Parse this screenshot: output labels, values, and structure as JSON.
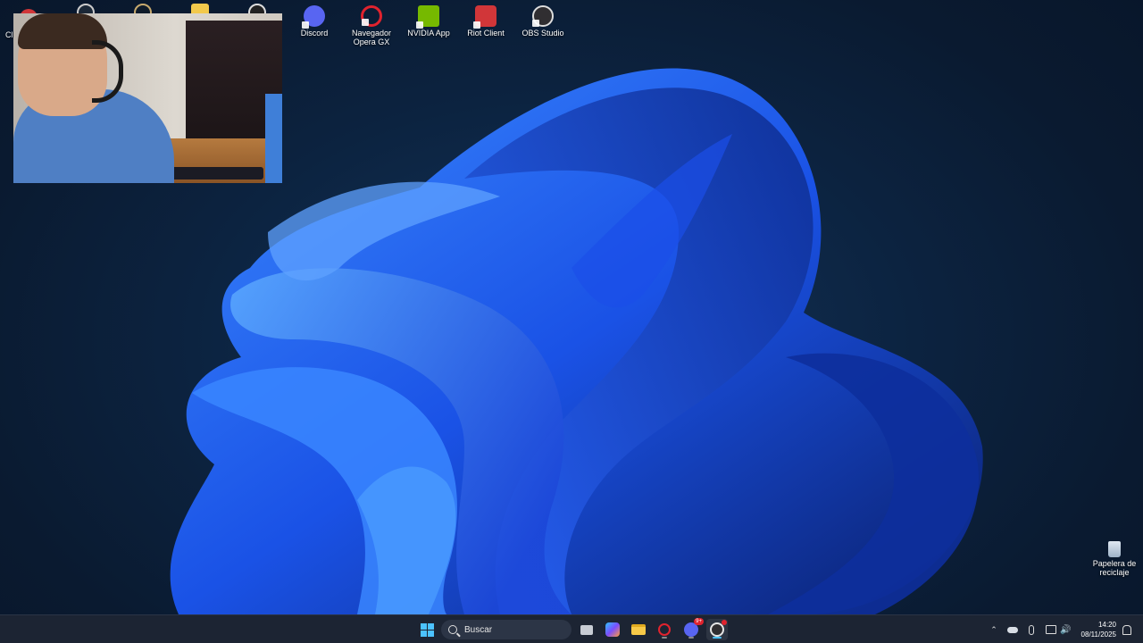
{
  "desktop_icons": [
    {
      "label": "Cli",
      "icon": "client-icon",
      "color": "#d13639"
    },
    {
      "label": "",
      "icon": "steam-icon",
      "color": "#1b2838"
    },
    {
      "label": "",
      "icon": "league-icon",
      "color": "#c8aa6e"
    },
    {
      "label": "",
      "icon": "folder-shortcut-icon",
      "color": "#f2c94c"
    },
    {
      "label": "",
      "icon": "logitech-icon",
      "color": "#222"
    },
    {
      "label": "Discord",
      "icon": "discord-icon",
      "color": "#5865f2"
    },
    {
      "label": "Navegador Opera GX",
      "icon": "opera-gx-icon",
      "color": "#e0232e"
    },
    {
      "label": "NVIDIA App",
      "icon": "nvidia-icon",
      "color": "#76b900"
    },
    {
      "label": "Riot Client",
      "icon": "riot-client-icon",
      "color": "#d13639"
    },
    {
      "label": "OBS Studio",
      "icon": "obs-studio-icon",
      "color": "#302e31"
    }
  ],
  "recycle_bin": {
    "label": "Papelera de reciclaje"
  },
  "taskbar": {
    "search_placeholder": "Buscar",
    "apps": [
      {
        "name": "task-view",
        "active": false
      },
      {
        "name": "copilot",
        "active": false
      },
      {
        "name": "file-explorer",
        "active": false
      },
      {
        "name": "opera-gx",
        "active": true
      },
      {
        "name": "discord",
        "active": true,
        "badge": "9+"
      },
      {
        "name": "obs-studio",
        "active": true
      }
    ],
    "time": "14:20",
    "date": "08/11/2025"
  },
  "colors": {
    "accent": "#4cc2ff",
    "taskbar_bg": "#1c2433"
  }
}
